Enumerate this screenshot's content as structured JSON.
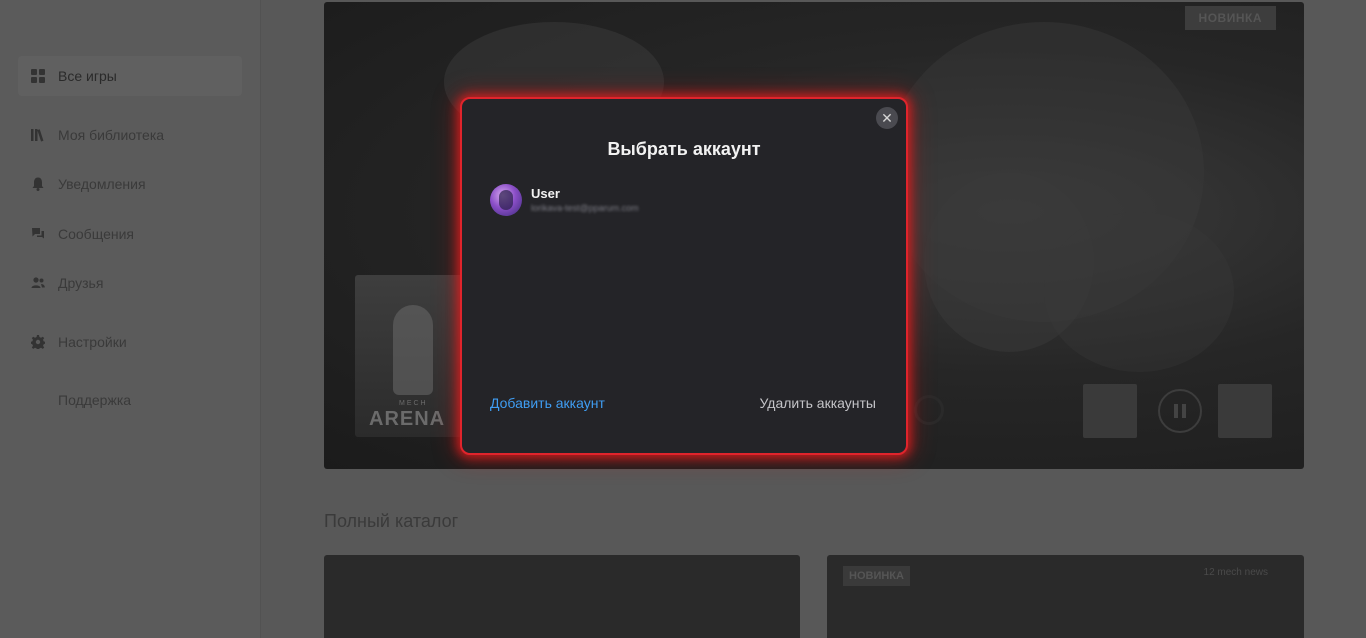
{
  "sidebar": {
    "items": [
      {
        "label": "Все игры",
        "icon": "grid-icon"
      },
      {
        "label": "Моя библиотека",
        "icon": "library-icon"
      },
      {
        "label": "Уведомления",
        "icon": "bell-icon"
      },
      {
        "label": "Сообщения",
        "icon": "chat-icon"
      },
      {
        "label": "Друзья",
        "icon": "friends-icon"
      },
      {
        "label": "Настройки",
        "icon": "gear-icon"
      },
      {
        "label": "Поддержка",
        "icon": ""
      }
    ]
  },
  "hero": {
    "badge": "НОВИНКА",
    "game_logo": "ARENA",
    "game_logo_sub": "MECH"
  },
  "catalog": {
    "title": "Полный каталог",
    "cards": [
      {
        "badge": "",
        "logo": ""
      },
      {
        "badge": "НОВИНКА",
        "logo": "12 mech news"
      }
    ]
  },
  "modal": {
    "title": "Выбрать аккаунт",
    "close_glyph": "✕",
    "account": {
      "name": "User",
      "email": "lorikava-test@pparum.com"
    },
    "add_label": "Добавить аккаунт",
    "remove_label": "Удалить аккаунты"
  },
  "colors": {
    "modal_border": "#e0242c",
    "link_blue": "#3f9df2",
    "modal_bg": "#242428"
  }
}
